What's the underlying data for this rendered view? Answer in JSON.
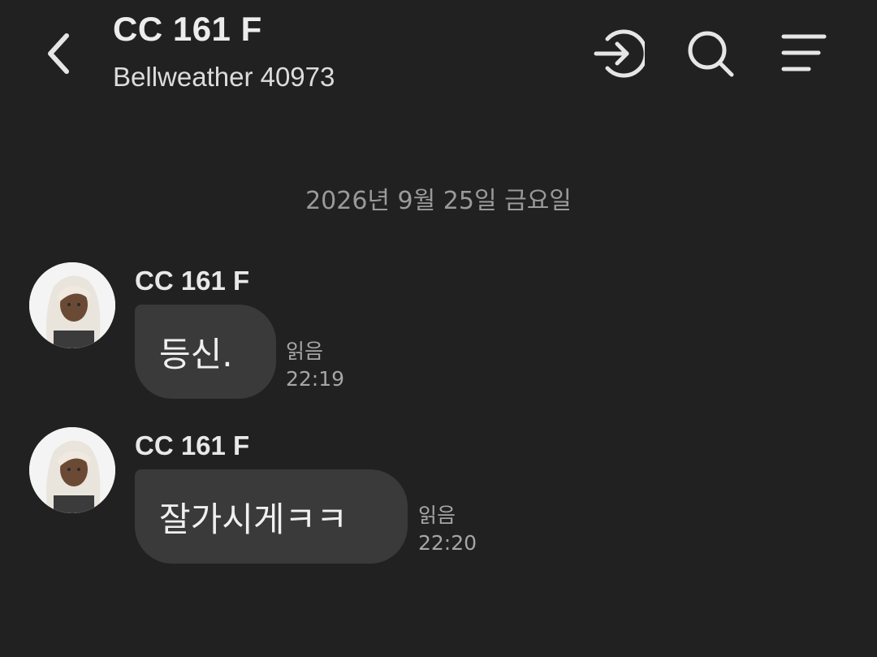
{
  "header": {
    "title": "CC 161 F",
    "subtitle": "Bellweather 40973",
    "icons": [
      "back-arrow-icon",
      "login-icon",
      "search-icon",
      "menu-icon"
    ]
  },
  "date_divider": "2026년 9월 25일 금요일",
  "messages": [
    {
      "sender": "CC 161 F",
      "text": "등신.",
      "read_status": "읽음",
      "time": "22:19"
    },
    {
      "sender": "CC 161 F",
      "text": "잘가시게ㅋㅋ",
      "read_status": "읽음",
      "time": "22:20"
    }
  ],
  "colors": {
    "background": "#212121",
    "bubble": "#3a3a3a",
    "text": "#ececec",
    "muted": "#9a9a9a"
  }
}
